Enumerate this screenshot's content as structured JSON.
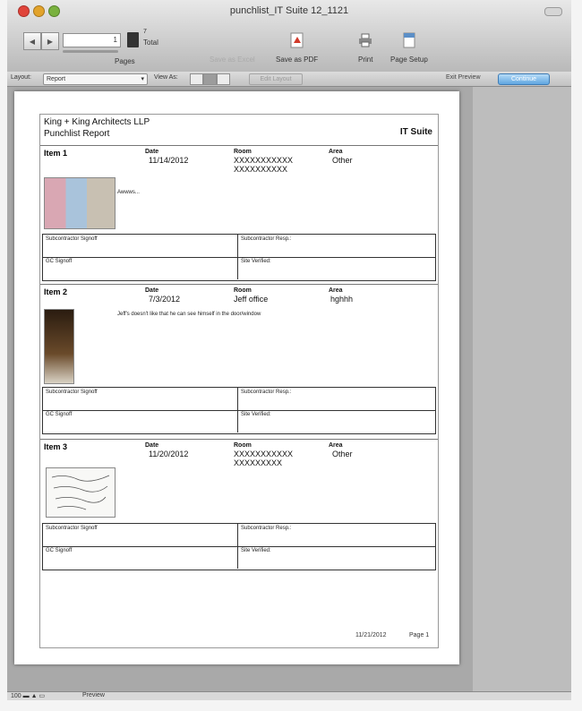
{
  "window": {
    "title": "punchlist_IT Suite 12_1121"
  },
  "toolbar": {
    "page_number": "1",
    "total_count": "7",
    "total_label": "Total",
    "pages_label": "Pages",
    "save_pdf_label": "Save as PDF",
    "print_label": "Print",
    "page_setup_label": "Page Setup",
    "save_excel_label": "Save as Excel"
  },
  "layout_bar": {
    "layout_label": "Layout:",
    "layout_value": "Report",
    "view_as_label": "View As:",
    "edit_layout_label": "Edit Layout",
    "exit_preview_label": "Exit Preview",
    "continue_label": "Continue"
  },
  "report": {
    "company": "King + King Architects LLP",
    "title": "Punchlist Report",
    "suite": "IT Suite",
    "footer_date": "11/21/2012",
    "footer_page": "Page 1",
    "field_labels": {
      "date": "Date",
      "room": "Room",
      "area": "Area"
    },
    "sign_labels": {
      "sub_signoff": "Subcontractor Signoff",
      "sub_resp": "Subcontractor Resp.:",
      "gc_signoff": "GC Signoff",
      "site_verified": "Site Verified:"
    },
    "items": [
      {
        "name": "Item 1",
        "date": "11/14/2012",
        "room": "XXXXXXXXXXX\nXXXXXXXXXX",
        "area": "Other",
        "note": "Awwws..."
      },
      {
        "name": "Item 2",
        "date": "7/3/2012",
        "room": "Jeff office",
        "area": "hghhh",
        "note": "Jeff's doesn't like that he can see himself in the door/window"
      },
      {
        "name": "Item 3",
        "date": "11/20/2012",
        "room": "XXXXXXXXXXX\nXXXXXXXXX",
        "area": "Other",
        "note": ""
      }
    ]
  },
  "statusbar": {
    "zoom": "100",
    "mode": "Preview"
  }
}
